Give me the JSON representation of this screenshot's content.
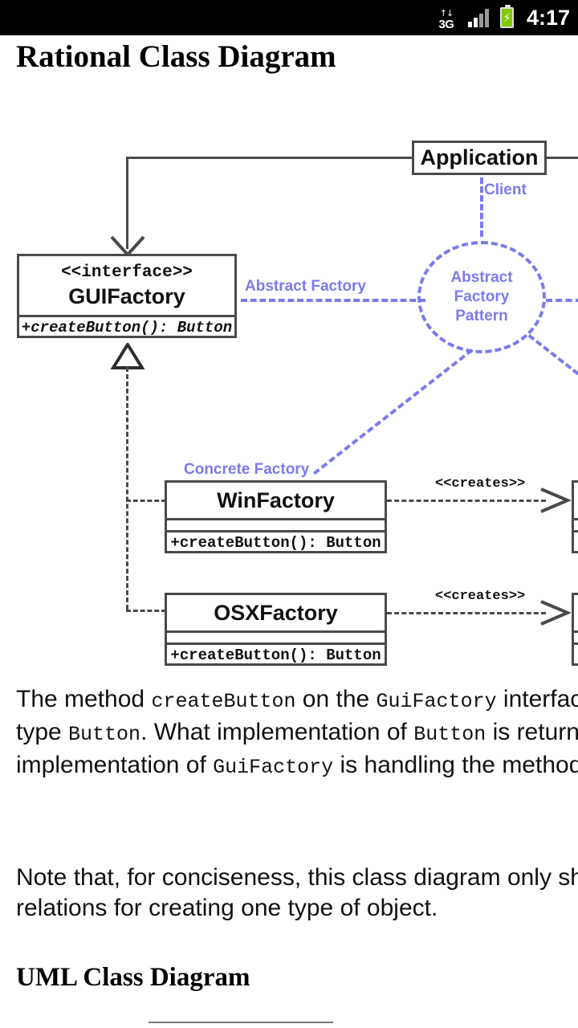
{
  "status_bar": {
    "network_type": "3G",
    "network_arrows": "↑↓",
    "signal_icon": "signal-bars-icon",
    "battery_icon": "battery-charging-icon",
    "battery_bolt": "⚡",
    "time": "4:17"
  },
  "page": {
    "title": "Rational Class Diagram",
    "subtitle": "UML Class Diagram"
  },
  "diagram": {
    "classes": {
      "application": {
        "name": "Application"
      },
      "guifactory": {
        "stereotype": "<<interface>>",
        "name": "GUIFactory",
        "method": "+createButton(): Button"
      },
      "winfactory": {
        "name": "WinFactory",
        "method": "+createButton(): Button"
      },
      "osxfactory": {
        "name": "OSXFactory",
        "method": "+createButton(): Button"
      }
    },
    "pattern_circle": {
      "line1": "Abstract",
      "line2": "Factory",
      "line3": "Pattern"
    },
    "role_labels": {
      "client": "Client",
      "abstract_factory": "Abstract Factory",
      "concrete_factory": "Concrete Factory"
    },
    "stereotype_labels": {
      "creates_win": "<<creates>>",
      "creates_osx": "<<creates>>"
    },
    "colors": {
      "pattern_blue": "#7b7bec",
      "line_gray": "#4a4a4a"
    }
  },
  "body": {
    "paragraph1": {
      "part1": "The method ",
      "code1": "createButton",
      "part2": " on the ",
      "code2": "GuiFactory",
      "part3": " interface returns objects of type ",
      "code3": "Button",
      "part4": ". What implementation of ",
      "code4": "Button",
      "part5": " is returned depends on which implementation of ",
      "code5": "GuiFactory",
      "part6": " is handling the method call."
    },
    "paragraph2": "Note that, for conciseness, this class diagram only shows the class relations for creating one type of object."
  }
}
